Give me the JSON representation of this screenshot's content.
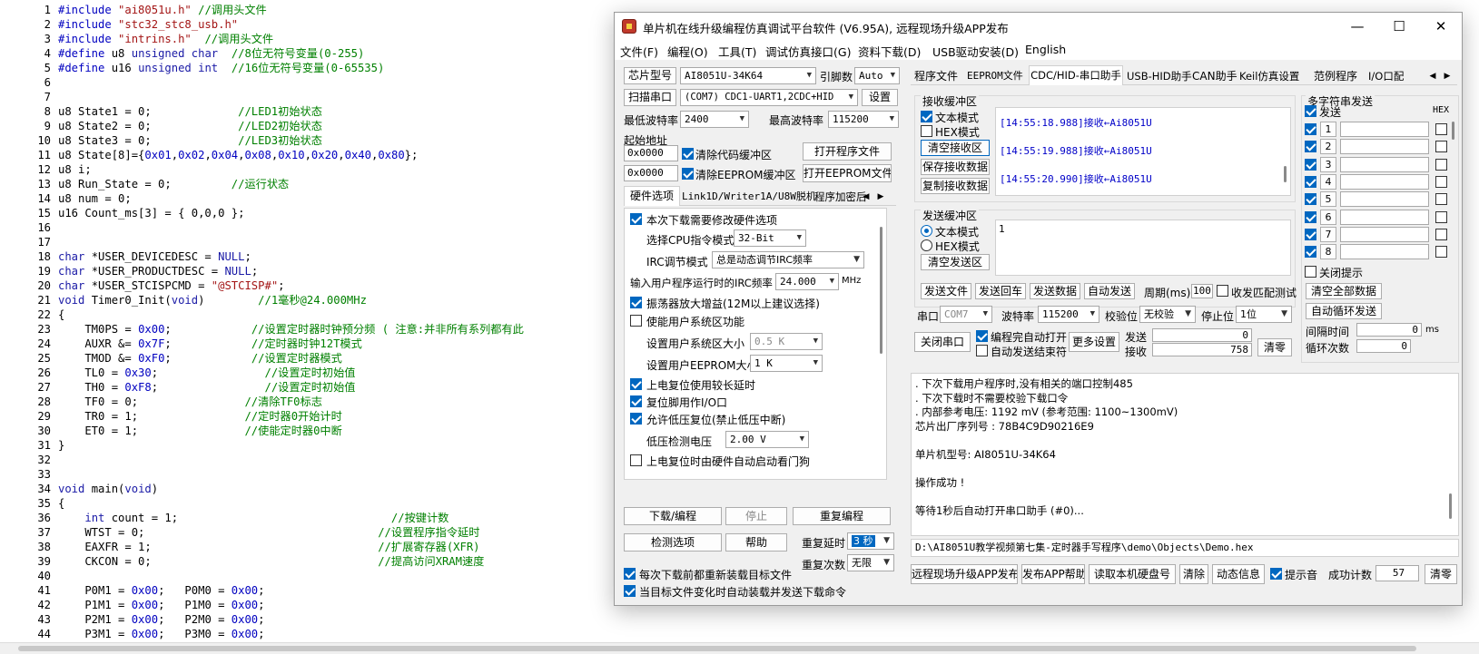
{
  "editor": {
    "lines": [
      {
        "n": "1",
        "t": "#include \"ai8051u.h\" //调用头文件"
      },
      {
        "n": "2",
        "t": "#include \"stc32_stc8_usb.h\""
      },
      {
        "n": "3",
        "t": "#include \"intrins.h\"  //调用头文件"
      },
      {
        "n": "4",
        "t": "#define u8 unsigned char  //8位无符号变量(0-255)"
      },
      {
        "n": "5",
        "t": "#define u16 unsigned int  //16位无符号变量(0-65535)"
      },
      {
        "n": "6",
        "t": ""
      },
      {
        "n": "7",
        "t": ""
      },
      {
        "n": "8",
        "t": "u8 State1 = 0;             //LED1初始状态"
      },
      {
        "n": "9",
        "t": "u8 State2 = 0;             //LED2初始状态"
      },
      {
        "n": "10",
        "t": "u8 State3 = 0;             //LED3初始状态"
      },
      {
        "n": "11",
        "t": "u8 State[8]={0x01,0x02,0x04,0x08,0x10,0x20,0x40,0x80};"
      },
      {
        "n": "12",
        "t": "u8 i;"
      },
      {
        "n": "13",
        "t": "u8 Run_State = 0;         //运行状态"
      },
      {
        "n": "14",
        "t": "u8 num = 0;"
      },
      {
        "n": "15",
        "t": "u16 Count_ms[3] = { 0,0,0 };"
      },
      {
        "n": "16",
        "t": ""
      },
      {
        "n": "17",
        "t": ""
      },
      {
        "n": "18",
        "t": "char *USER_DEVICEDESC = NULL;"
      },
      {
        "n": "19",
        "t": "char *USER_PRODUCTDESC = NULL;"
      },
      {
        "n": "20",
        "t": "char *USER_STCISPCMD = \"@STCISP#\";"
      },
      {
        "n": "21",
        "t": "void Timer0_Init(void)        //1毫秒@24.000MHz"
      },
      {
        "n": "22",
        "t": "{"
      },
      {
        "n": "23",
        "t": "    TM0PS = 0x00;            //设置定时器时钟预分频 ( 注意:并非所有系列都有此"
      },
      {
        "n": "24",
        "t": "    AUXR &= 0x7F;            //定时器时钟12T模式"
      },
      {
        "n": "25",
        "t": "    TMOD &= 0xF0;            //设置定时器模式"
      },
      {
        "n": "26",
        "t": "    TL0 = 0x30;                //设置定时初始值"
      },
      {
        "n": "27",
        "t": "    TH0 = 0xF8;                //设置定时初始值"
      },
      {
        "n": "28",
        "t": "    TF0 = 0;                //清除TF0标志"
      },
      {
        "n": "29",
        "t": "    TR0 = 1;                //定时器0开始计时"
      },
      {
        "n": "30",
        "t": "    ET0 = 1;                //使能定时器0中断"
      },
      {
        "n": "31",
        "t": "}"
      },
      {
        "n": "32",
        "t": ""
      },
      {
        "n": "33",
        "t": ""
      },
      {
        "n": "34",
        "t": "void main(void)"
      },
      {
        "n": "35",
        "t": "{"
      },
      {
        "n": "36",
        "t": "    int count = 1;                                //按键计数"
      },
      {
        "n": "37",
        "t": "    WTST = 0;                                   //设置程序指令延时"
      },
      {
        "n": "38",
        "t": "    EAXFR = 1;                                  //扩展寄存器(XFR)"
      },
      {
        "n": "39",
        "t": "    CKCON = 0;                                  //提高访问XRAM速度"
      },
      {
        "n": "40",
        "t": ""
      },
      {
        "n": "41",
        "t": "    P0M1 = 0x00;   P0M0 = 0x00;"
      },
      {
        "n": "42",
        "t": "    P1M1 = 0x00;   P1M0 = 0x00;"
      },
      {
        "n": "43",
        "t": "    P2M1 = 0x00;   P2M0 = 0x00;"
      },
      {
        "n": "44",
        "t": "    P3M1 = 0x00;   P3M0 = 0x00;"
      }
    ]
  },
  "window": {
    "title": "单片机在线升级编程仿真调试平台软件 (V6.95A), 远程现场升级APP发布",
    "controls": [
      "—",
      "☐",
      "✕"
    ],
    "menu": [
      "文件(F)",
      "编程(O)",
      "工具(T)",
      "调试仿真接口(G)",
      "资料下载(D)",
      "USB驱动安装(D)",
      "English"
    ],
    "left": {
      "chip_btn": "芯片型号",
      "chip_value": "AI8051U-34K64",
      "pin_label": "引脚数",
      "pin_value": "Auto",
      "scan_btn": "扫描串口",
      "port_value": "(COM7) CDC1-UART1,2CDC+HID",
      "settings_btn": "设置",
      "min_baud_label": "最低波特率",
      "min_baud": "2400",
      "max_baud_label": "最高波特率",
      "max_baud": "115200",
      "start_addr_label": "起始地址",
      "addr1": "0x0000",
      "clear_code": "清除代码缓冲区",
      "open_prog": "打开程序文件",
      "addr2": "0x0000",
      "clear_eeprom": "清除EEPROM缓冲区",
      "open_eeprom": "打开EEPROM文件",
      "tabs": [
        "硬件选项",
        "Link1D/Writer1A/U8W脱机",
        "程序加密后"
      ],
      "hw": {
        "opt1": "本次下载需要修改硬件选项",
        "cpu_label": "选择CPU指令模式",
        "cpu_value": "32-Bit",
        "irc_label": "IRC调节模式",
        "irc_value": "总是动态调节IRC频率",
        "freq_label": "输入用户程序运行时的IRC频率",
        "freq_value": "24.000",
        "freq_unit": "MHz",
        "opt2": "振荡器放大增益(12M以上建议选择)",
        "opt3": "使能用户系统区功能",
        "sys_label": "设置用户系统区大小",
        "sys_value": "0.5 K",
        "ee_label": "设置用户EEPROM大小",
        "ee_value": "1   K",
        "opt4": "上电复位使用较长延时",
        "opt5": "复位脚用作I/O口",
        "opt6": "允许低压复位(禁止低压中断)",
        "lv_label": "低压检测电压",
        "lv_value": "2.00 V",
        "opt7": "上电复位时由硬件自动启动看门狗"
      },
      "download_btn": "下载/编程",
      "stop_btn": "停止",
      "reprog_btn": "重复编程",
      "detect_btn": "检测选项",
      "help_btn": "帮助",
      "delay_label": "重复延时",
      "delay_value": "3 秒",
      "count_label": "重复次数",
      "count_value": "无限",
      "chk_reload": "每次下载前都重新装载目标文件",
      "chk_auto": "当目标文件变化时自动装载并发送下载命令"
    },
    "right": {
      "tabs": [
        "程序文件",
        "EEPROM文件",
        "CDC/HID-串口助手",
        "USB-HID助手",
        "CAN助手",
        "Keil仿真设置",
        "范例程序",
        "I/O口配"
      ],
      "recv_title": "接收缓冲区",
      "recv_text": "文本模式",
      "recv_hex": "HEX模式",
      "recv_clear": "清空接收区",
      "recv_save": "保存接收数据",
      "recv_copy": "复制接收数据",
      "recv_lines": [
        "[14:55:18.988]接收←Ai8051U",
        "[14:55:19.988]接收←Ai8051U",
        "[14:55:20.990]接收←Ai8051U"
      ],
      "send_title": "发送缓冲区",
      "send_text": "文本模式",
      "send_hex": "HEX模式",
      "send_clear": "清空发送区",
      "send_value": "1",
      "btns": [
        "发送文件",
        "发送回车",
        "发送数据",
        "自动发送"
      ],
      "period_label": "周期(ms)",
      "period": "100",
      "match": "收发匹配测试",
      "port_label": "串口",
      "port": "COM7",
      "baud_label": "波特率",
      "baud": "115200",
      "parity_label": "校验位",
      "parity": "无校验",
      "stop_label": "停止位",
      "stop": "1位",
      "close_port": "关闭串口",
      "auto_open": "编程完自动打开",
      "auto_end": "自动发送结束符",
      "more": "更多设置",
      "send_label": "发送",
      "send_count": "0",
      "recv_label": "接收",
      "recv_count": "758",
      "clear_btn": "清零",
      "multi": {
        "title": "多字符串发送",
        "send_hdr": "发送",
        "hex_hdr": "HEX",
        "rows": [
          "1",
          "2",
          "3",
          "4",
          "5",
          "6",
          "7",
          "8"
        ],
        "close_tip": "关闭提示",
        "clear_all": "清空全部数据",
        "auto_loop": "自动循环发送",
        "interval_label": "间隔时间",
        "interval": "0",
        "interval_unit": "ms",
        "loops_label": "循环次数",
        "loops": "0"
      }
    },
    "log": [
      ". 下次下载用户程序时,没有相关的端口控制485",
      ". 下次下载时不需要校验下载口令",
      ". 内部参考电压: 1192 mV (参考范围: 1100~1300mV)",
      "芯片出厂序列号 : 78B4C9D90216E9",
      "",
      "  单片机型号: AI8051U-34K64",
      "",
      "操作成功 !",
      "",
      "等待1秒后自动打开串口助手 (#0)..."
    ],
    "path": "D:\\AI8051U教学视频第七集-定时器手写程序\\demo\\Objects\\Demo.hex",
    "bottom": {
      "b1": "远程现场升级APP发布",
      "b2": "发布APP帮助",
      "b3": "读取本机硬盘号",
      "b4": "清除",
      "b5": "动态信息",
      "beep": "提示音",
      "succ_label": "成功计数",
      "succ": "57",
      "clr": "清零"
    }
  }
}
